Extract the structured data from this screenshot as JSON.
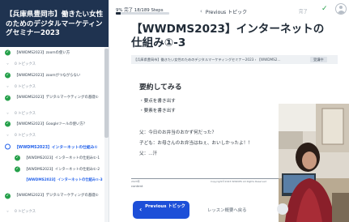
{
  "topbar": {
    "progress_text": "9% 完了 18/189 Steps",
    "progress_fraction": 0.095,
    "prev_label": "Previous トピック",
    "completed_label": "完了",
    "check_icon": "check-icon",
    "avatar_icon": "user-avatar-icon"
  },
  "sidebar": {
    "course_title": "【兵庫県豊岡市】働きたい女性のためのデジタルマーケティングセミナー2023",
    "items": [
      {
        "label": "【WWDMS2023】zoomの使い方",
        "kind": "lesson",
        "icon": "✓"
      },
      {
        "label": "0 トピックス",
        "kind": "topics",
        "icon": "⌄"
      },
      {
        "label": "【WWDMS2023】zoomがつながらない",
        "kind": "lesson",
        "icon": "✓"
      },
      {
        "label": "0 トピックス",
        "kind": "topics",
        "icon": "⌄"
      },
      {
        "label": "【WWDMS2023】デジタルマーケティングの基礎①",
        "kind": "lesson tall",
        "icon": "✓"
      },
      {
        "label": "0 トピックス",
        "kind": "topics",
        "icon": "⌄"
      },
      {
        "label": "【WWDMS2023】Googleツールの使い方?",
        "kind": "lesson",
        "icon": "✓"
      },
      {
        "label": "0 トピックス",
        "kind": "topics",
        "icon": "⌄"
      },
      {
        "label": "【WWDMS2023】インターネットの仕組み①",
        "kind": "lesson active-lesson",
        "icon": ""
      },
      {
        "label": "【WWDMS2023】インターネットの仕組み①-1",
        "kind": "sub",
        "icon": "✓"
      },
      {
        "label": "【WWDMS2023】インターネットの仕組み①-2",
        "kind": "sub",
        "icon": "✓"
      },
      {
        "label": "【WWDMS2023】インターネットの仕組み①-3",
        "kind": "sub current",
        "icon": ""
      },
      {
        "label": "【WWDMS2023】デジタルマーケティングの基礎②",
        "kind": "lesson tall",
        "icon": "✓"
      },
      {
        "label": "0 トピックス",
        "kind": "topics",
        "icon": "⌄"
      }
    ]
  },
  "main": {
    "title": "【WWDMS2023】インターネットの仕組み①-3",
    "breadcrumb": "【兵庫県豊岡市】働きたい女性のためのデジタルマーケティングセミナー2023 › 【WWDMS2…",
    "status_badge": "受講中",
    "slide": {
      "heading": "要約してみる",
      "bullets": [
        "・要点を書き出す",
        "・要素を書き出す"
      ],
      "lines": [
        "父：今日のお弁当のおかず何だった？",
        "子ども：お母さんのお弁当はねぇ、おいしかったよ！！",
        "父：...汗"
      ],
      "footer_left": "2023年",
      "footer_center": "Copyright©2023 WWDMS All Rights Reserved",
      "content_label": "content"
    },
    "nav": {
      "prev_topic": "Previous トピック",
      "back_link": "レッスン概要へ戻る"
    }
  }
}
